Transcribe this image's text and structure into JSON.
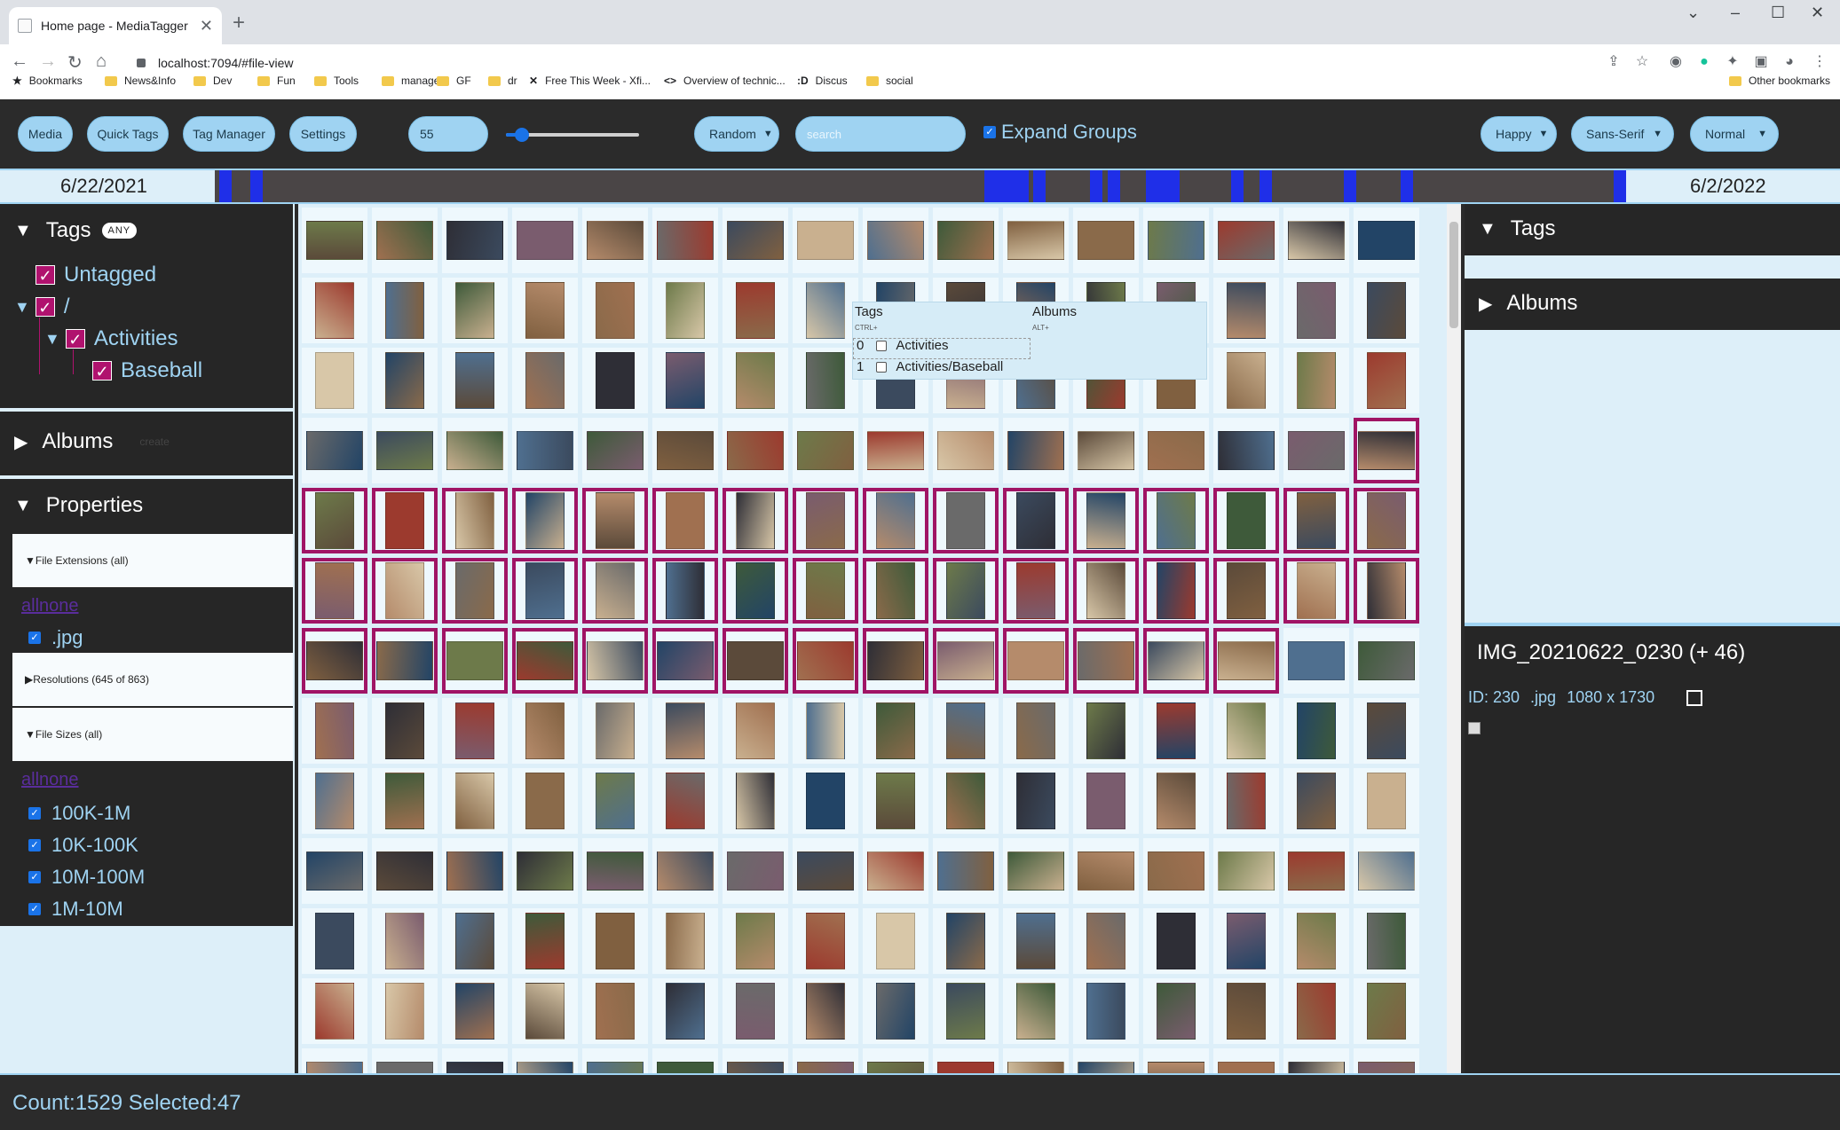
{
  "browser": {
    "tab_title": "Home page - MediaTagger",
    "url": "localhost:7094/#file-view",
    "bookmarks": [
      "Bookmarks",
      "News&Info",
      "Dev",
      "Fun",
      "Tools",
      "manage",
      "GF",
      "dr",
      "Free This Week - Xfi...",
      "Overview of technic...",
      "Discus",
      "social"
    ],
    "other_bookmarks": "Other bookmarks"
  },
  "toolbar": {
    "media": "Media",
    "quick_tags": "Quick Tags",
    "tag_manager": "Tag Manager",
    "settings": "Settings",
    "size_value": "55",
    "size_fraction": 0.12,
    "sort": "Random",
    "search_placeholder": "search",
    "expand_groups": "Expand Groups",
    "theme": "Happy",
    "font": "Sans-Serif",
    "density": "Normal"
  },
  "timeline": {
    "start": "6/22/2021",
    "end": "6/2/2022",
    "marks": [
      0.003,
      0.025,
      0.545,
      0.56,
      0.58,
      0.62,
      0.633,
      0.66,
      0.667,
      0.675,
      0.72,
      0.74,
      0.8,
      0.84,
      0.995
    ]
  },
  "left": {
    "tags_header": "Tags",
    "any_badge": "ANY",
    "untagged": "Untagged",
    "root": "/",
    "activities": "Activities",
    "baseball": "Baseball",
    "albums_header": "Albums",
    "albums_create": "create",
    "properties_header": "Properties",
    "file_ext_header": "▼File Extensions (all)",
    "allnone": "allnone",
    "jpg": ".jpg",
    "resolutions_header": "▶Resolutions (645 of 863)",
    "file_sizes_header": "▼File Sizes (all)",
    "sizes": [
      "100K-1M",
      "10K-100K",
      "10M-100M",
      "1M-10M"
    ]
  },
  "popup": {
    "tags_title": "Tags",
    "tags_hint": "CTRL+",
    "albums_title": "Albums",
    "albums_hint": "ALT+",
    "rows": [
      {
        "index": "0",
        "label": "Activities"
      },
      {
        "index": "1",
        "label": "Activities/Baseball"
      }
    ]
  },
  "right": {
    "tags_header": "Tags",
    "albums_header": "Albums",
    "file_title": "IMG_20210622_0230 (+ 46)",
    "id": "ID: 230",
    "ext": ".jpg",
    "resolution": "1080 x 1730"
  },
  "status": "Count:1529 Selected:47",
  "colors": {
    "accent": "#9fd3f2",
    "selection": "#a01465",
    "panel_dark": "#262626",
    "timeline_mark": "#1f2fe8"
  }
}
